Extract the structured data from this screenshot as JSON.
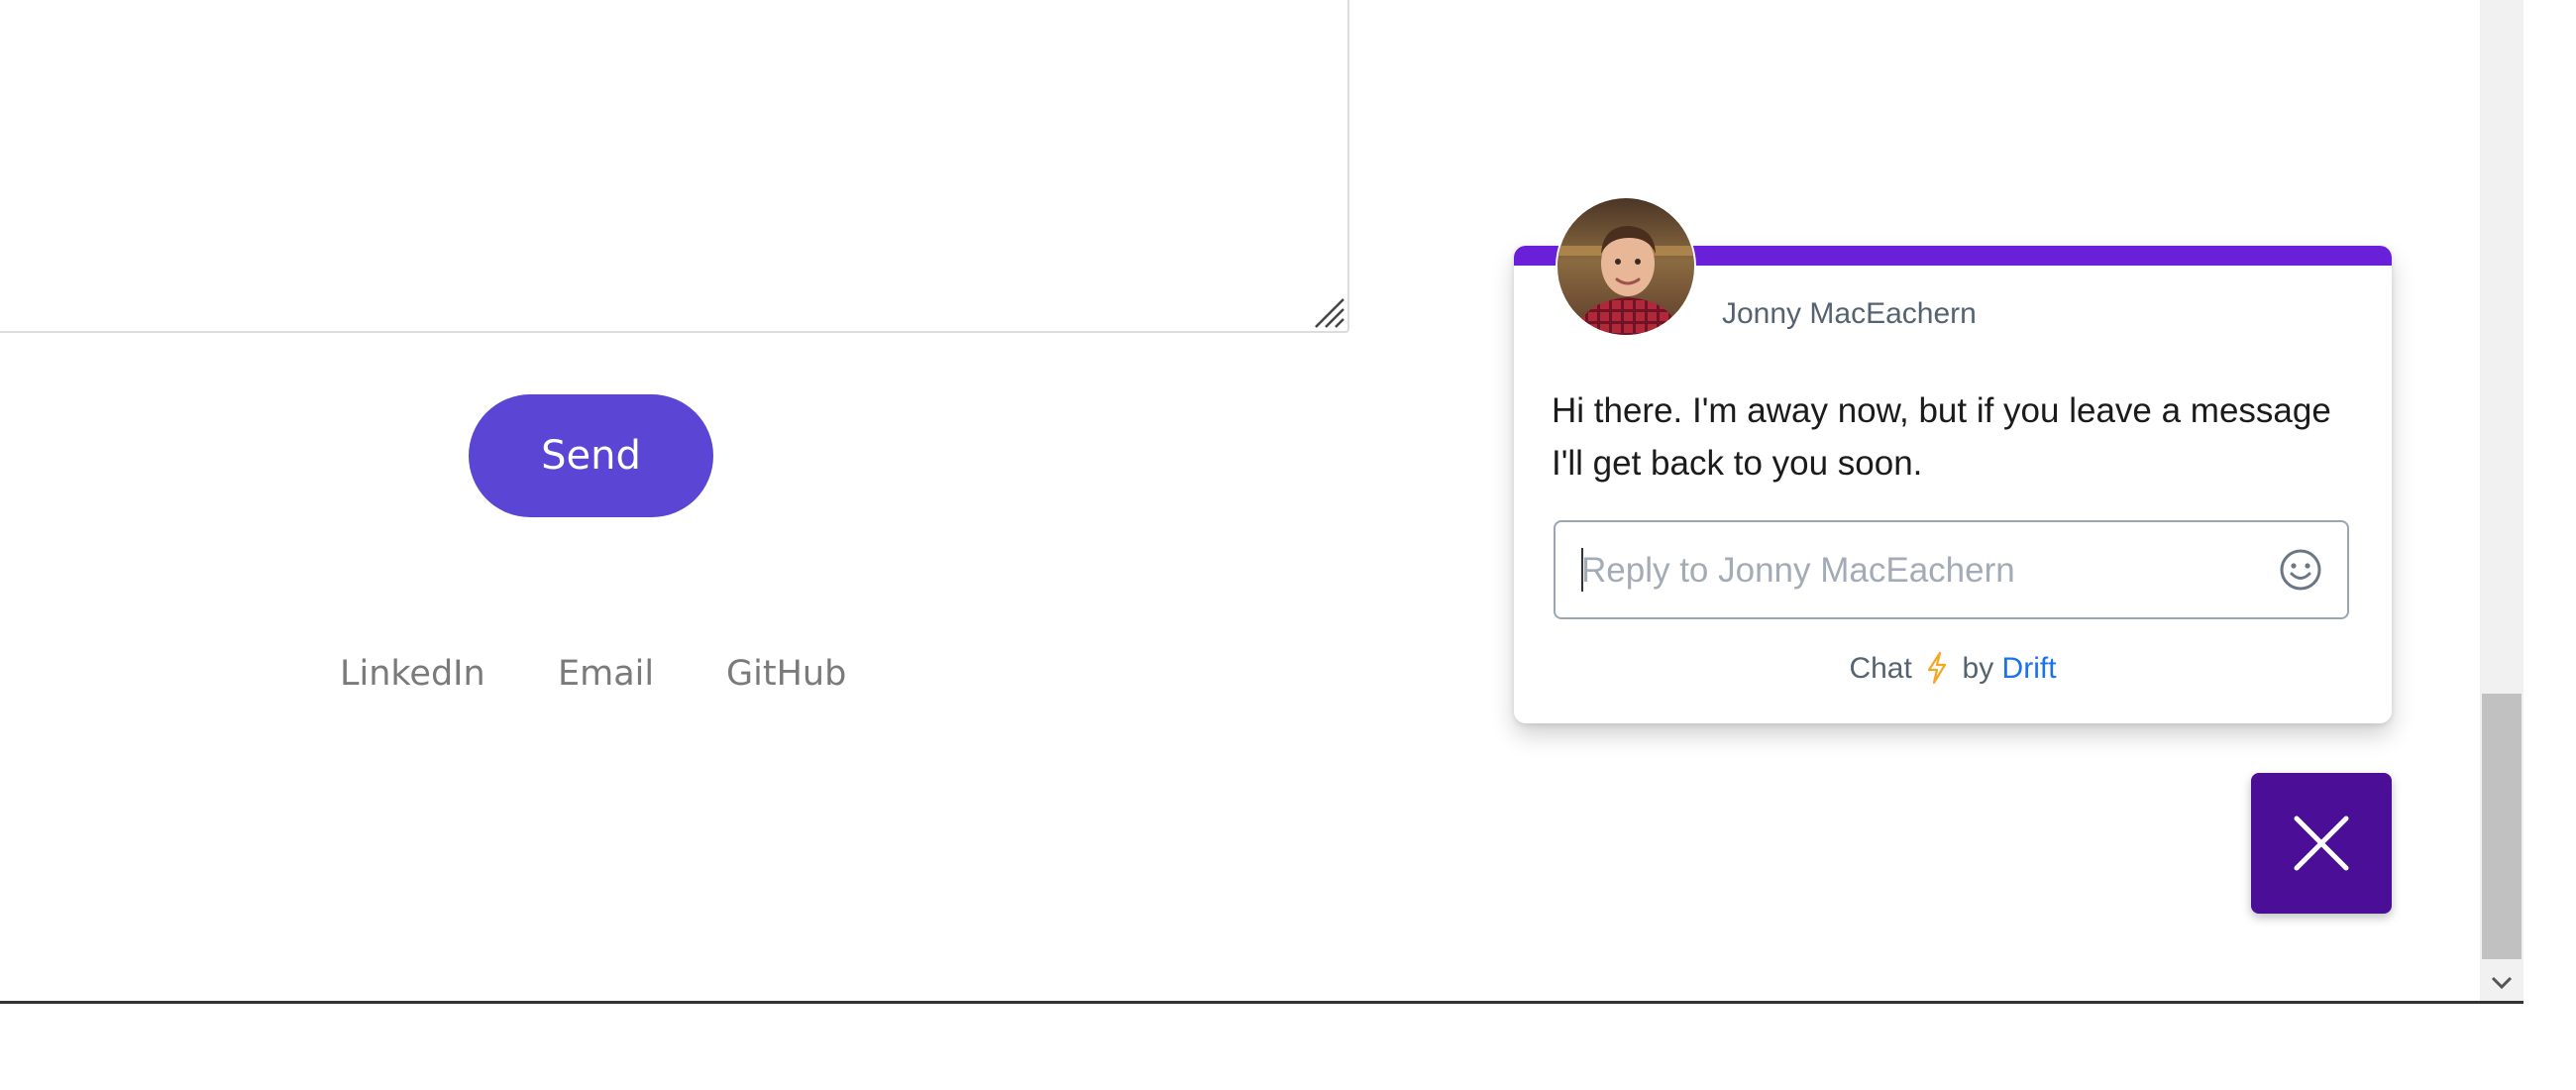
{
  "contact_form": {
    "send_label": "Send"
  },
  "footer": {
    "links": [
      "LinkedIn",
      "Email",
      "GitHub"
    ]
  },
  "chat": {
    "agent_name": "Jonny MacEachern",
    "message": "Hi there. I'm away now, but if you leave a message I'll get back to you soon.",
    "reply_placeholder": "Reply to Jonny MacEachern",
    "powered_prefix": "Chat",
    "powered_by": "by",
    "powered_brand": "Drift",
    "colors": {
      "topbar": "#6a1fd8",
      "close_button": "#4a0f96",
      "brand_link": "#1a73e8",
      "bolt": "#f5a623"
    },
    "icons": {
      "emoji": "smiley-icon",
      "close": "close-icon",
      "bolt": "lightning-bolt-icon"
    }
  },
  "accent_color": "#5a45d4"
}
